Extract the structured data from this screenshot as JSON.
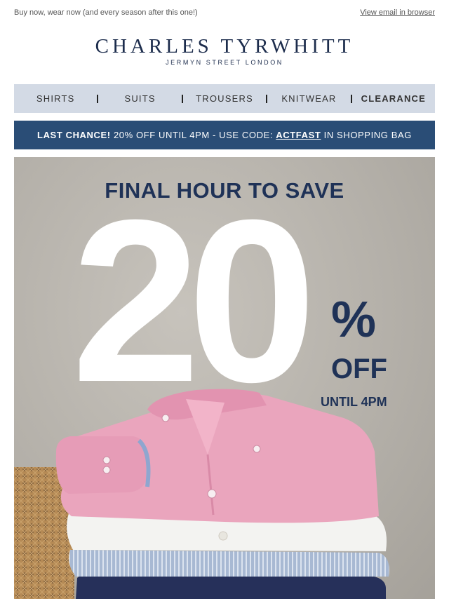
{
  "preheader": {
    "left_text": "Buy now, wear now (and every season after this one!)",
    "view_in_browser": "View email in browser"
  },
  "brand": {
    "name": "CHARLES TYRWHITT",
    "tagline": "JERMYN STREET LONDON"
  },
  "nav": {
    "items": [
      {
        "label": "SHIRTS"
      },
      {
        "label": "SUITS"
      },
      {
        "label": "TROUSERS"
      },
      {
        "label": "KNITWEAR"
      },
      {
        "label": "CLEARANCE"
      }
    ]
  },
  "banner": {
    "lead": "LAST CHANCE!",
    "middle": " 20% OFF UNTIL 4PM - USE CODE: ",
    "code": "ACTFAST",
    "tail": " IN SHOPPING BAG"
  },
  "hero": {
    "headline": "FINAL HOUR TO SAVE",
    "big_number": "20",
    "percent": "%",
    "off": "OFF",
    "until": "UNTIL 4PM"
  },
  "colors": {
    "navy": "#1f3257",
    "banner_blue": "#2a4d76",
    "nav_bg": "#d3dae5",
    "shirt_pink": "#eaa5bd"
  }
}
